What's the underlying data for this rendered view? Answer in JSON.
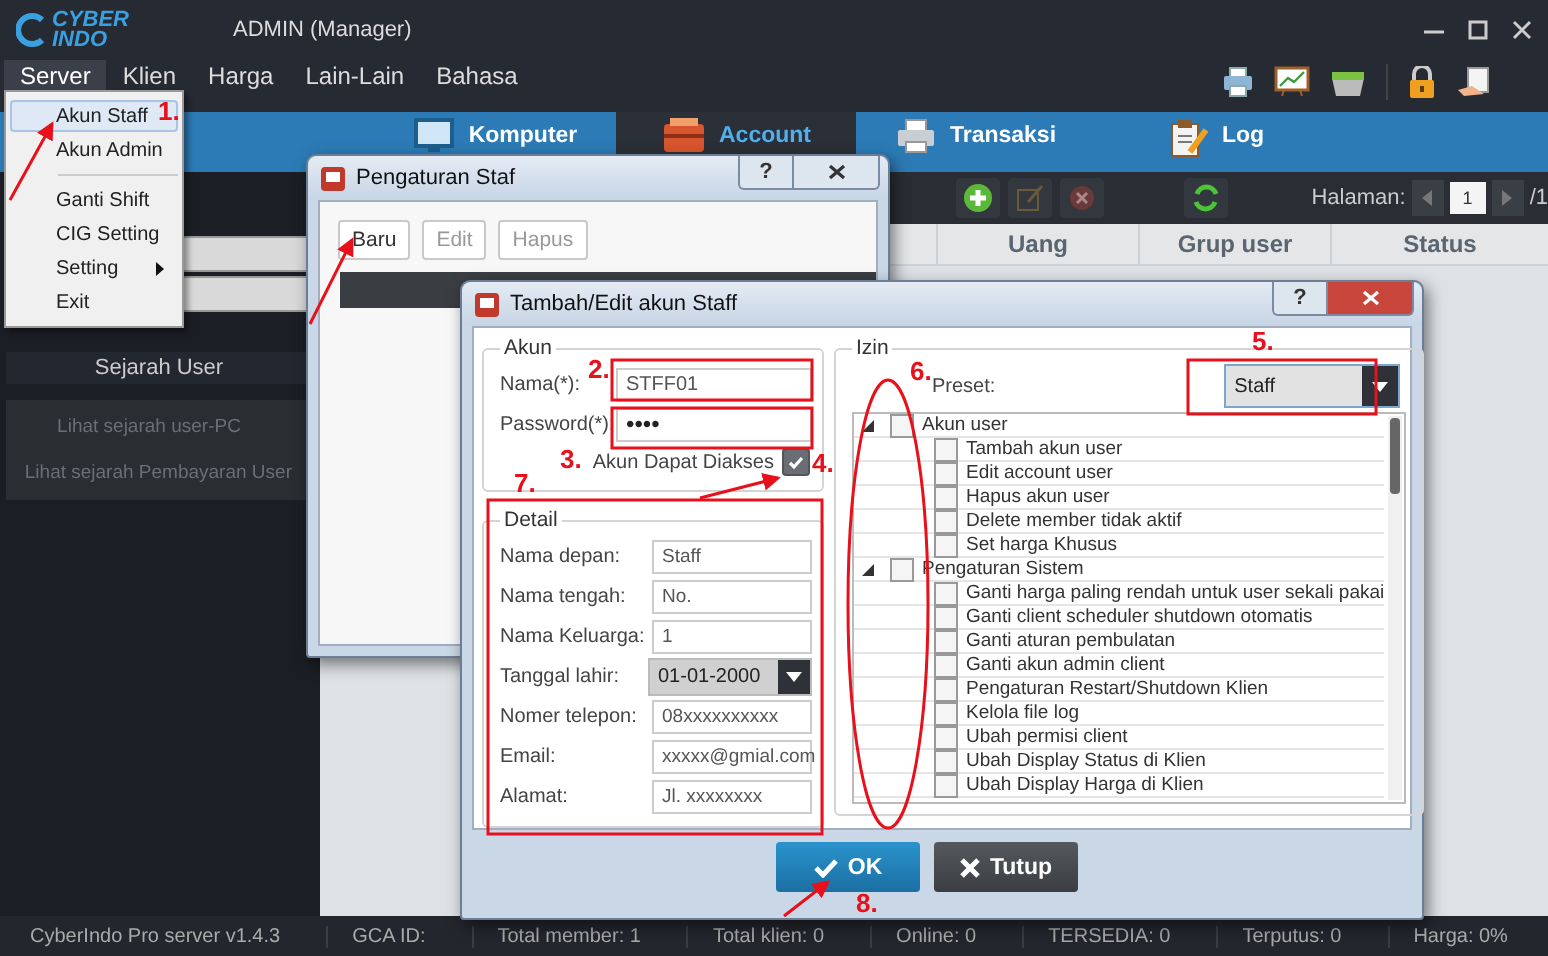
{
  "app": {
    "logo_top": "CYBER",
    "logo_bottom": "INDO",
    "title": "ADMIN (Manager)"
  },
  "menu_bar": [
    {
      "label": "Server",
      "selected": true
    },
    {
      "label": "Klien",
      "selected": false
    },
    {
      "label": "Harga",
      "selected": false
    },
    {
      "label": "Lain-Lain",
      "selected": false
    },
    {
      "label": "Bahasa",
      "selected": false
    }
  ],
  "server_menu": [
    {
      "kind": "item",
      "label": "Akun Staff",
      "selected": true
    },
    {
      "kind": "item",
      "label": "Akun Admin",
      "selected": false
    },
    {
      "kind": "separator"
    },
    {
      "kind": "item",
      "label": "Ganti Shift",
      "selected": false
    },
    {
      "kind": "item",
      "label": "CIG Setting",
      "selected": false
    },
    {
      "kind": "submenu",
      "label": "Setting",
      "selected": false
    },
    {
      "kind": "item",
      "label": "Exit",
      "selected": false
    }
  ],
  "nav_tabs": [
    {
      "kind": "monitor",
      "label": "Komputer",
      "selected": false
    },
    {
      "kind": "cashbox",
      "label": "Account",
      "selected": true
    },
    {
      "kind": "printer",
      "label": "Transaksi",
      "selected": false
    },
    {
      "kind": "clipboard",
      "label": "Log",
      "selected": false
    }
  ],
  "toolbar": {
    "page_label": "Halaman:",
    "page": "1",
    "page_total": "/1"
  },
  "table": {
    "columns": [
      "Uang",
      "Grup user",
      "Status"
    ]
  },
  "sidebar": {
    "title": "Sejarah User",
    "links": [
      "Lihat sejarah user-PC",
      "Lihat sejarah Pembayaran User"
    ]
  },
  "staff_dialog": {
    "title": "Pengaturan Staf",
    "help": "?",
    "buttons": [
      {
        "label": "Baru",
        "disabled": false
      },
      {
        "label": "Edit",
        "disabled": true
      },
      {
        "label": "Hapus",
        "disabled": true
      }
    ]
  },
  "account_dialog": {
    "title": "Tambah/Edit akun Staff",
    "help": "?",
    "akun": {
      "legend": "Akun",
      "fields": [
        {
          "label": "Nama(*):",
          "value": "STFF01"
        },
        {
          "label": "Password(*):",
          "value": "••••"
        }
      ],
      "access": {
        "label": "Akun Dapat Diakses",
        "checked": true
      }
    },
    "detail": {
      "legend": "Detail",
      "fields": [
        {
          "kind": "text",
          "label": "Nama depan:",
          "value": "Staff"
        },
        {
          "kind": "text",
          "label": "Nama tengah:",
          "value": "No."
        },
        {
          "kind": "text",
          "label": "Nama Keluarga:",
          "value": "1"
        },
        {
          "kind": "date",
          "label": "Tanggal lahir:",
          "value": "01-01-2000"
        },
        {
          "kind": "text",
          "label": "Nomer telepon:",
          "value": "08xxxxxxxxxx"
        },
        {
          "kind": "text",
          "label": "Email:",
          "value": "xxxxx@gmial.com"
        },
        {
          "kind": "text",
          "label": "Alamat:",
          "value": "Jl. xxxxxxxx"
        }
      ]
    },
    "izin": {
      "legend": "Izin",
      "preset_label": "Preset:",
      "preset": "Staff",
      "tree": [
        {
          "label": "Akun user",
          "checked": false,
          "expanded": true,
          "children": [
            {
              "label": "Tambah akun user",
              "checked": false
            },
            {
              "label": "Edit account user",
              "checked": false
            },
            {
              "label": "Hapus akun user",
              "checked": false
            },
            {
              "label": "Delete member tidak aktif",
              "checked": false
            },
            {
              "label": "Set harga Khusus",
              "checked": false
            }
          ]
        },
        {
          "label": "Pengaturan Sistem",
          "checked": false,
          "expanded": true,
          "children": [
            {
              "label": "Ganti harga paling rendah untuk user sekali pakai",
              "checked": false
            },
            {
              "label": "Ganti client scheduler shutdown otomatis",
              "checked": false
            },
            {
              "label": "Ganti aturan pembulatan",
              "checked": false
            },
            {
              "label": "Ganti akun admin client",
              "checked": false
            },
            {
              "label": "Pengaturan Restart/Shutdown Klien",
              "checked": false
            },
            {
              "label": "Kelola file log",
              "checked": false
            },
            {
              "label": "Ubah permisi client",
              "checked": false
            },
            {
              "label": "Ubah Display Status di Klien",
              "checked": false
            },
            {
              "label": "Ubah Display Harga di Klien",
              "checked": false
            }
          ]
        }
      ]
    },
    "buttons": [
      {
        "kind": "ok",
        "label": "OK"
      },
      {
        "kind": "close",
        "label": "Tutup"
      }
    ]
  },
  "annotations": [
    {
      "label": "1."
    },
    {
      "label": "2."
    },
    {
      "label": "3."
    },
    {
      "label": "4."
    },
    {
      "label": "5."
    },
    {
      "label": "6."
    },
    {
      "label": "7."
    },
    {
      "label": "8."
    }
  ],
  "status_bar": [
    "CyberIndo Pro server v1.4.3",
    "GCA ID:",
    "Total member: 1",
    "Total klien: 0",
    "Online: 0",
    "TERSEDIA: 0",
    "Terputus: 0",
    "Harga: 0%"
  ]
}
